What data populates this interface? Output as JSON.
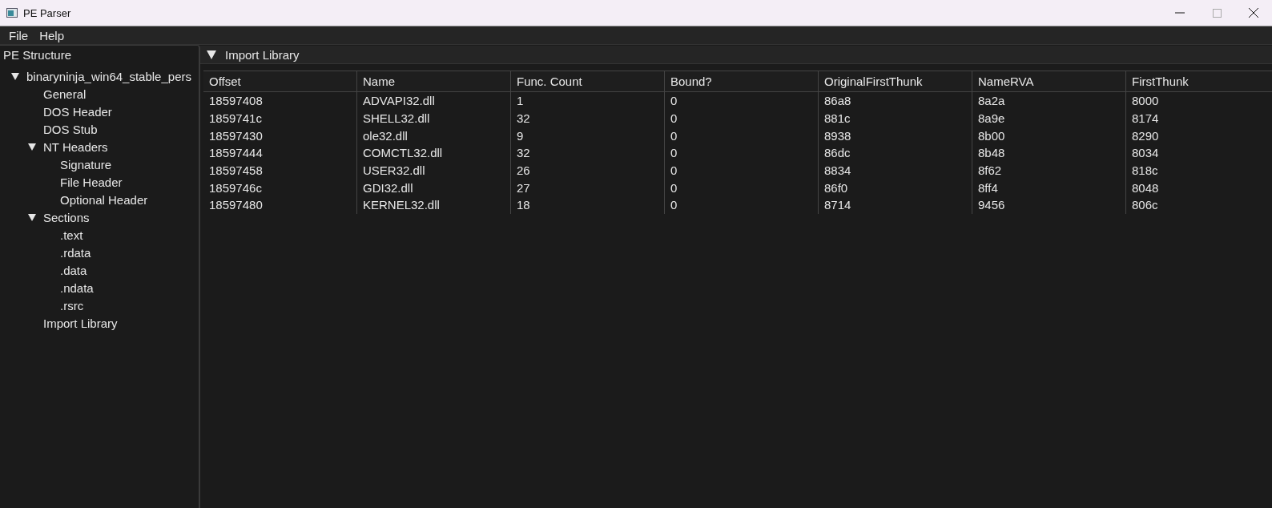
{
  "window": {
    "title": "PE Parser"
  },
  "menu": [
    "File",
    "Help"
  ],
  "sidebar": {
    "title": "PE Structure",
    "tree": [
      {
        "label": "binaryninja_win64_stable_pers",
        "expanded": true,
        "children": [
          {
            "label": "General"
          },
          {
            "label": "DOS Header"
          },
          {
            "label": "DOS Stub"
          },
          {
            "label": "NT Headers",
            "expanded": true,
            "children": [
              {
                "label": "Signature"
              },
              {
                "label": "File Header"
              },
              {
                "label": "Optional Header"
              }
            ]
          },
          {
            "label": "Sections",
            "expanded": true,
            "children": [
              {
                "label": ".text"
              },
              {
                "label": ".rdata"
              },
              {
                "label": ".data"
              },
              {
                "label": ".ndata"
              },
              {
                "label": ".rsrc"
              }
            ]
          },
          {
            "label": "Import Library"
          }
        ]
      }
    ]
  },
  "panel": {
    "title": "Import Library",
    "expanded": true
  },
  "table": {
    "columns": [
      "Offset",
      "Name",
      "Func. Count",
      "Bound?",
      "OriginalFirstThunk",
      "NameRVA",
      "FirstThunk"
    ],
    "rows": [
      [
        "18597408",
        "ADVAPI32.dll",
        "1",
        "0",
        "86a8",
        "8a2a",
        "8000"
      ],
      [
        "1859741c",
        "SHELL32.dll",
        "32",
        "0",
        "881c",
        "8a9e",
        "8174"
      ],
      [
        "18597430",
        "ole32.dll",
        "9",
        "0",
        "8938",
        "8b00",
        "8290"
      ],
      [
        "18597444",
        "COMCTL32.dll",
        "32",
        "0",
        "86dc",
        "8b48",
        "8034"
      ],
      [
        "18597458",
        "USER32.dll",
        "26",
        "0",
        "8834",
        "8f62",
        "818c"
      ],
      [
        "1859746c",
        "GDI32.dll",
        "27",
        "0",
        "86f0",
        "8ff4",
        "8048"
      ],
      [
        "18597480",
        "KERNEL32.dll",
        "18",
        "0",
        "8714",
        "9456",
        "806c"
      ]
    ]
  }
}
